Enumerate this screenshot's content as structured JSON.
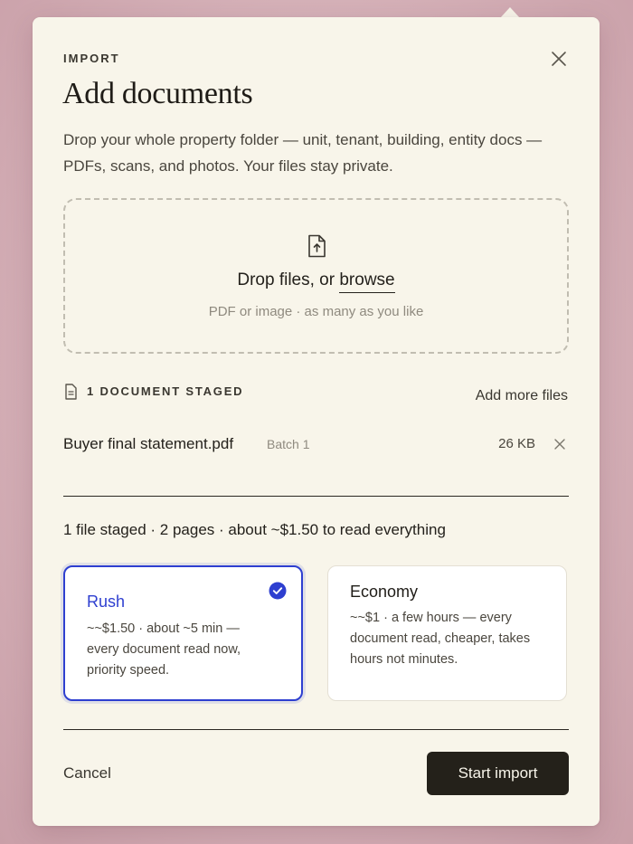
{
  "header": {
    "eyebrow": "IMPORT",
    "title": "Add documents",
    "subtitle": "Drop your whole property folder — unit, tenant, building, entity docs — PDFs, scans, and photos. Your files stay private."
  },
  "dropzone": {
    "prompt": "Drop files, or ",
    "browse_label": "browse",
    "hint": "PDF or image · as many as you like"
  },
  "staged": {
    "count_label": "1 DOCUMENT STAGED",
    "add_more_label": "Add more files",
    "files": [
      {
        "name": "Buyer final statement.pdf",
        "batch": "Batch 1",
        "size": "26 KB"
      }
    ]
  },
  "summary": "1 file staged · 2 pages · about ~$1.50 to read everything",
  "options": [
    {
      "name": "Rush",
      "desc": "~~$1.50 · about ~5 min — every document read now, priority speed.",
      "selected": true
    },
    {
      "name": "Economy",
      "desc": "~~$1 · a few hours — every document read, cheaper, takes hours not minutes.",
      "selected": false
    }
  ],
  "footer": {
    "cancel_label": "Cancel",
    "start_label": "Start import"
  },
  "colors": {
    "accent": "#2e3fd0",
    "primary_button": "#24211a",
    "panel": "#f8f5ea"
  }
}
